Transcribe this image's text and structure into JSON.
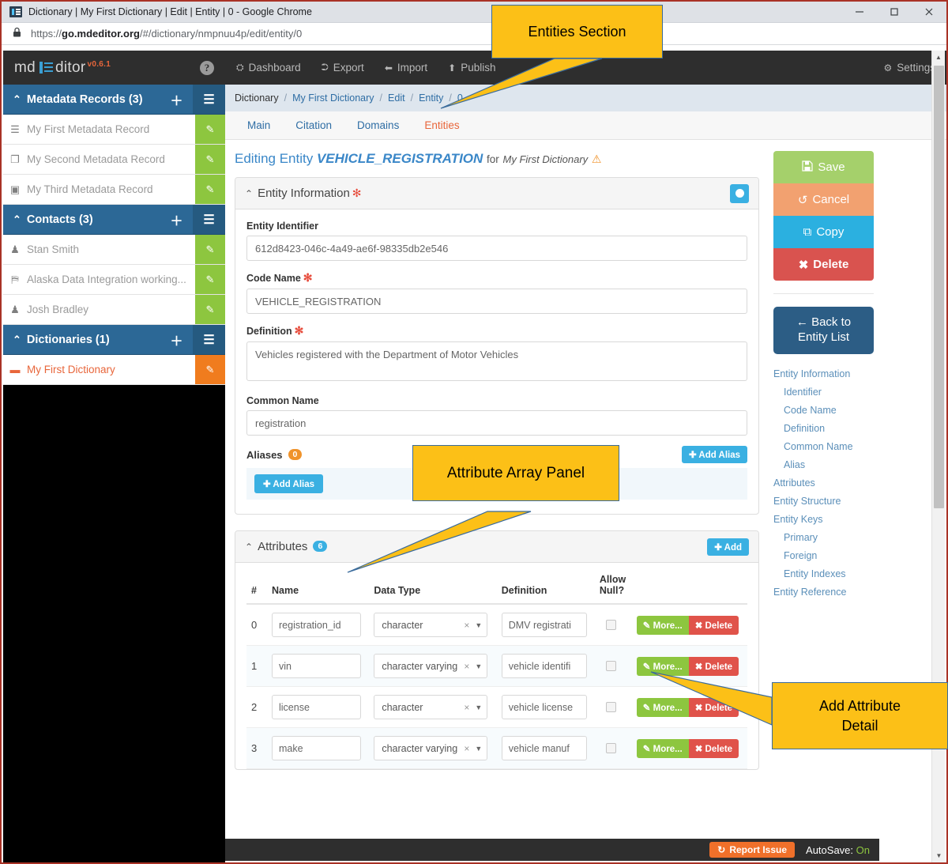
{
  "browser": {
    "title": "Dictionary | My First Dictionary | Edit | Entity | 0 - Google Chrome",
    "url_prefix": "https://",
    "url_host": "go.mdeditor.org",
    "url_path": "/#/dictionary/nmpnuu4p/edit/entity/0",
    "minimize": "—",
    "maximize": "□",
    "close": "✕"
  },
  "sidebar": {
    "brand_pre": "md",
    "brand_post": "ditor",
    "version": "v0.6.1",
    "help": "?",
    "groups": [
      {
        "label": "Metadata Records (3)",
        "caret": "⌃",
        "add": "＋",
        "list": "☰",
        "items": [
          {
            "label": "My First Metadata Record",
            "icon": "☰",
            "active": false
          },
          {
            "label": "My Second Metadata Record",
            "icon": "❐",
            "active": false
          },
          {
            "label": "My Third Metadata Record",
            "icon": "▣",
            "active": false
          }
        ]
      },
      {
        "label": "Contacts (3)",
        "caret": "⌃",
        "add": "＋",
        "list": "☰",
        "items": [
          {
            "label": "Stan Smith",
            "icon": "♟",
            "active": false
          },
          {
            "label": "Alaska Data Integration working...",
            "icon": "⛿",
            "active": false
          },
          {
            "label": "Josh Bradley",
            "icon": "♟",
            "active": false
          }
        ]
      },
      {
        "label": "Dictionaries (1)",
        "caret": "⌃",
        "add": "＋",
        "list": "☰",
        "items": [
          {
            "label": "My First Dictionary",
            "icon": "▬",
            "active": true
          }
        ]
      }
    ],
    "edit_icon": "✎"
  },
  "topnav": {
    "items": [
      {
        "label": "Dashboard",
        "icon": "⛭"
      },
      {
        "label": "Export",
        "icon": "⮊"
      },
      {
        "label": "Import",
        "icon": "⬅"
      },
      {
        "label": "Publish",
        "icon": "⬆"
      }
    ],
    "settings": {
      "label": "Settings",
      "icon": "⚙"
    }
  },
  "breadcrumb": [
    "Dictionary",
    "My First Dictionary",
    "Edit",
    "Entity",
    "0"
  ],
  "tabs": [
    {
      "label": "Main",
      "active": false
    },
    {
      "label": "Citation",
      "active": false
    },
    {
      "label": "Domains",
      "active": false
    },
    {
      "label": "Entities",
      "active": true
    }
  ],
  "page": {
    "heading_pre": "Editing Entity",
    "entity_name": "VEHICLE_REGISTRATION",
    "heading_for": "for",
    "dictionary": "My First Dictionary",
    "warning_icon": "⚠"
  },
  "entity_information": {
    "title": "Entity Information",
    "caret": "⌃",
    "required_mark": "✻",
    "fields": {
      "identifier_label": "Entity Identifier",
      "identifier_value": "612d8423-046c-4a49-ae6f-98335db2e546",
      "code_name_label": "Code Name",
      "code_name_value": "VEHICLE_REGISTRATION",
      "definition_label": "Definition",
      "definition_value": "Vehicles registered with the Department of Motor Vehicles",
      "common_name_label": "Common Name",
      "common_name_value": "registration"
    },
    "aliases": {
      "label": "Aliases",
      "count": "0",
      "add_button": "Add Alias",
      "add_button_inner": "Add Alias"
    }
  },
  "attributes_panel": {
    "title": "Attributes",
    "caret": "⌃",
    "count": "6",
    "add_button": "Add",
    "columns": [
      "#",
      "Name",
      "Data Type",
      "Definition",
      "Allow Null?",
      ""
    ],
    "allow_null_line1": "Allow",
    "allow_null_line2": "Null?",
    "more_label": "More...",
    "delete_label": "Delete",
    "rows": [
      {
        "index": "0",
        "name": "registration_id",
        "data_type": "character",
        "definition": "DMV registrati",
        "allow_null": false
      },
      {
        "index": "1",
        "name": "vin",
        "data_type": "character varying",
        "definition": "vehicle identifi",
        "allow_null": false
      },
      {
        "index": "2",
        "name": "license",
        "data_type": "character",
        "definition": "vehicle license",
        "allow_null": false
      },
      {
        "index": "3",
        "name": "make",
        "data_type": "character varying",
        "definition": "vehicle manuf",
        "allow_null": false
      }
    ]
  },
  "actions": {
    "save": "Save",
    "save_icon": "💾",
    "cancel": "Cancel",
    "cancel_icon": "↺",
    "copy": "Copy",
    "copy_icon": "⧉",
    "delete": "Delete",
    "delete_icon": "✖",
    "back_icon": "←",
    "back_line1": "Back to",
    "back_line2": "Entity List"
  },
  "nav_links": [
    {
      "label": "Entity Information",
      "sub": false
    },
    {
      "label": "Identifier",
      "sub": true
    },
    {
      "label": "Code Name",
      "sub": true
    },
    {
      "label": "Definition",
      "sub": true
    },
    {
      "label": "Common Name",
      "sub": true
    },
    {
      "label": "Alias",
      "sub": true
    },
    {
      "label": "Attributes",
      "sub": false
    },
    {
      "label": "Entity Structure",
      "sub": false
    },
    {
      "label": "Entity Keys",
      "sub": false
    },
    {
      "label": "Primary",
      "sub": true
    },
    {
      "label": "Foreign",
      "sub": true
    },
    {
      "label": "Entity Indexes",
      "sub": true
    },
    {
      "label": "Entity Reference",
      "sub": false
    }
  ],
  "statusbar": {
    "report_icon": "↻",
    "report_label": "Report Issue",
    "autosave_label": "AutoSave:",
    "autosave_value": "On"
  },
  "callouts": {
    "entities_section": "Entities Section",
    "attribute_array_panel": "Attribute Array Panel",
    "add_attribute_detail_line1": "Add Attribute",
    "add_attribute_detail_line2": "Detail"
  },
  "colors": {
    "accent_blue": "#3ab0e2",
    "nav_blue": "#2c6896",
    "active_orange": "#e8663b",
    "green": "#8dc63f",
    "red": "#d9534f",
    "callout_yellow": "#fcc017"
  }
}
